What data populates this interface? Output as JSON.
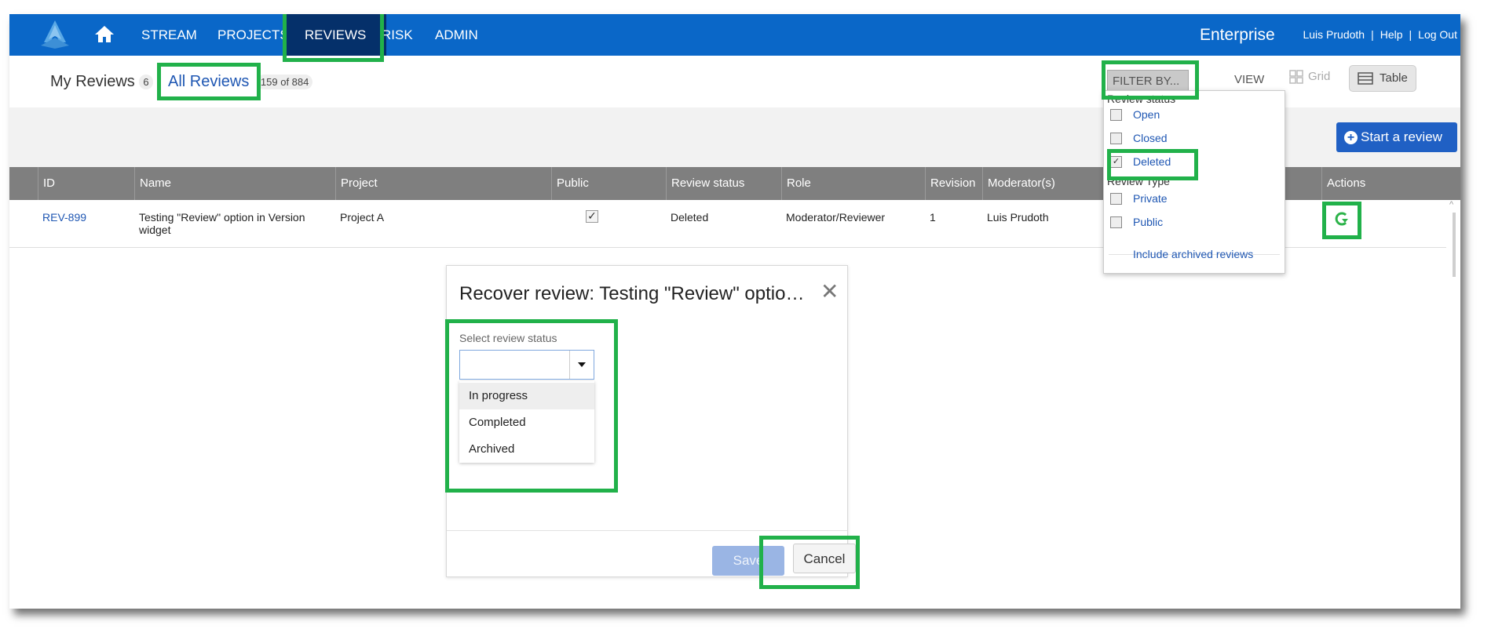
{
  "nav": {
    "items": [
      {
        "label": "STREAM"
      },
      {
        "label": "PROJECTS"
      },
      {
        "label": "REVIEWS"
      },
      {
        "label": "RISK"
      },
      {
        "label": "ADMIN"
      }
    ],
    "brand": "Enterprise",
    "user_name": "Luis Prudoth",
    "help": "Help",
    "logout": "Log Out",
    "separator": "|"
  },
  "tabs": {
    "my_reviews": "My Reviews",
    "my_reviews_count": "6",
    "all_reviews": "All Reviews",
    "all_reviews_count": "159 of 884"
  },
  "toolbar": {
    "filter_label": "FILTER BY...",
    "view_label": "VIEW",
    "grid_label": "Grid",
    "table_label": "Table",
    "start_review": "Start a review"
  },
  "filter": {
    "review_status_heading": "Review status",
    "status_options": [
      {
        "label": "Open",
        "checked": false
      },
      {
        "label": "Closed",
        "checked": false
      },
      {
        "label": "Deleted",
        "checked": true
      }
    ],
    "review_type_heading": "Review Type",
    "type_options": [
      {
        "label": "Private",
        "checked": false
      },
      {
        "label": "Public",
        "checked": false
      }
    ],
    "include_archived": "Include archived reviews"
  },
  "table": {
    "columns": [
      "ID",
      "Name",
      "Project",
      "Public",
      "Review status",
      "Role",
      "Revision",
      "Moderator(s)",
      "Actions"
    ],
    "rows": [
      {
        "id": "REV-899",
        "name": "Testing \"Review\" option in Version widget",
        "project": "Project A",
        "public": true,
        "status": "Deleted",
        "role": "Moderator/Reviewer",
        "revision": "1",
        "moderator": "Luis Prudoth"
      }
    ]
  },
  "modal": {
    "title": "Recover review: Testing \"Review\" option in Version widget",
    "select_label": "Select review status",
    "select_value": "",
    "options": [
      "In progress",
      "Completed",
      "Archived"
    ],
    "save": "Save",
    "cancel": "Cancel",
    "close_icon": "close-icon"
  },
  "colors": {
    "nav_bg": "#0a67c8",
    "nav_active": "#05306a",
    "highlight": "#21b14a",
    "link": "#1f57b3"
  }
}
